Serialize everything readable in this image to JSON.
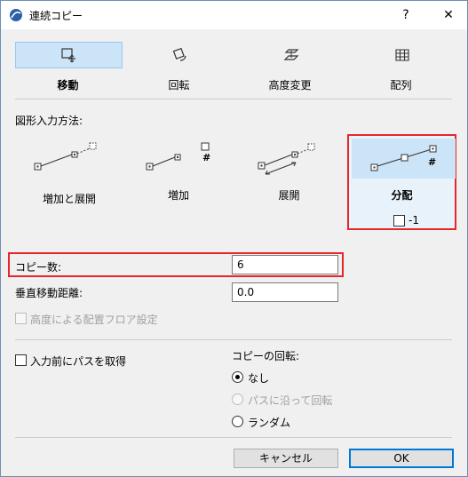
{
  "window": {
    "title": "連続コピー",
    "help_label": "?",
    "close_label": "✕"
  },
  "tabs": [
    {
      "label": "移動",
      "icon": "move-icon",
      "selected": true
    },
    {
      "label": "回転",
      "icon": "rotate-icon",
      "selected": false
    },
    {
      "label": "高度変更",
      "icon": "elevate-icon",
      "selected": false
    },
    {
      "label": "配列",
      "icon": "array-icon",
      "selected": false
    }
  ],
  "input_method": {
    "heading": "図形入力方法:",
    "options": [
      {
        "label": "増加と展開",
        "selected": false
      },
      {
        "label": "増加",
        "selected": false,
        "hash": "#"
      },
      {
        "label": "展開",
        "selected": false
      },
      {
        "label": "分配",
        "selected": true,
        "hash": "#",
        "checkbox_label": "-1"
      }
    ]
  },
  "fields": {
    "copies_label": "コピー数:",
    "copies_value": "6",
    "vertical_label": "垂直移動距離:",
    "vertical_value": "0.0",
    "floor_setting_label": "高度による配置フロア設定"
  },
  "path": {
    "label": "入力前にパスを取得"
  },
  "rotation": {
    "heading": "コピーの回転:",
    "options": [
      {
        "label": "なし",
        "selected": true,
        "disabled": false
      },
      {
        "label": "パスに沿って回転",
        "selected": false,
        "disabled": true
      },
      {
        "label": "ランダム",
        "selected": false,
        "disabled": false
      }
    ]
  },
  "buttons": {
    "cancel": "キャンセル",
    "ok": "OK"
  },
  "colors": {
    "accent": "#0078d7",
    "highlight": "#e8262a",
    "selected_bg": "#cce4f7"
  }
}
